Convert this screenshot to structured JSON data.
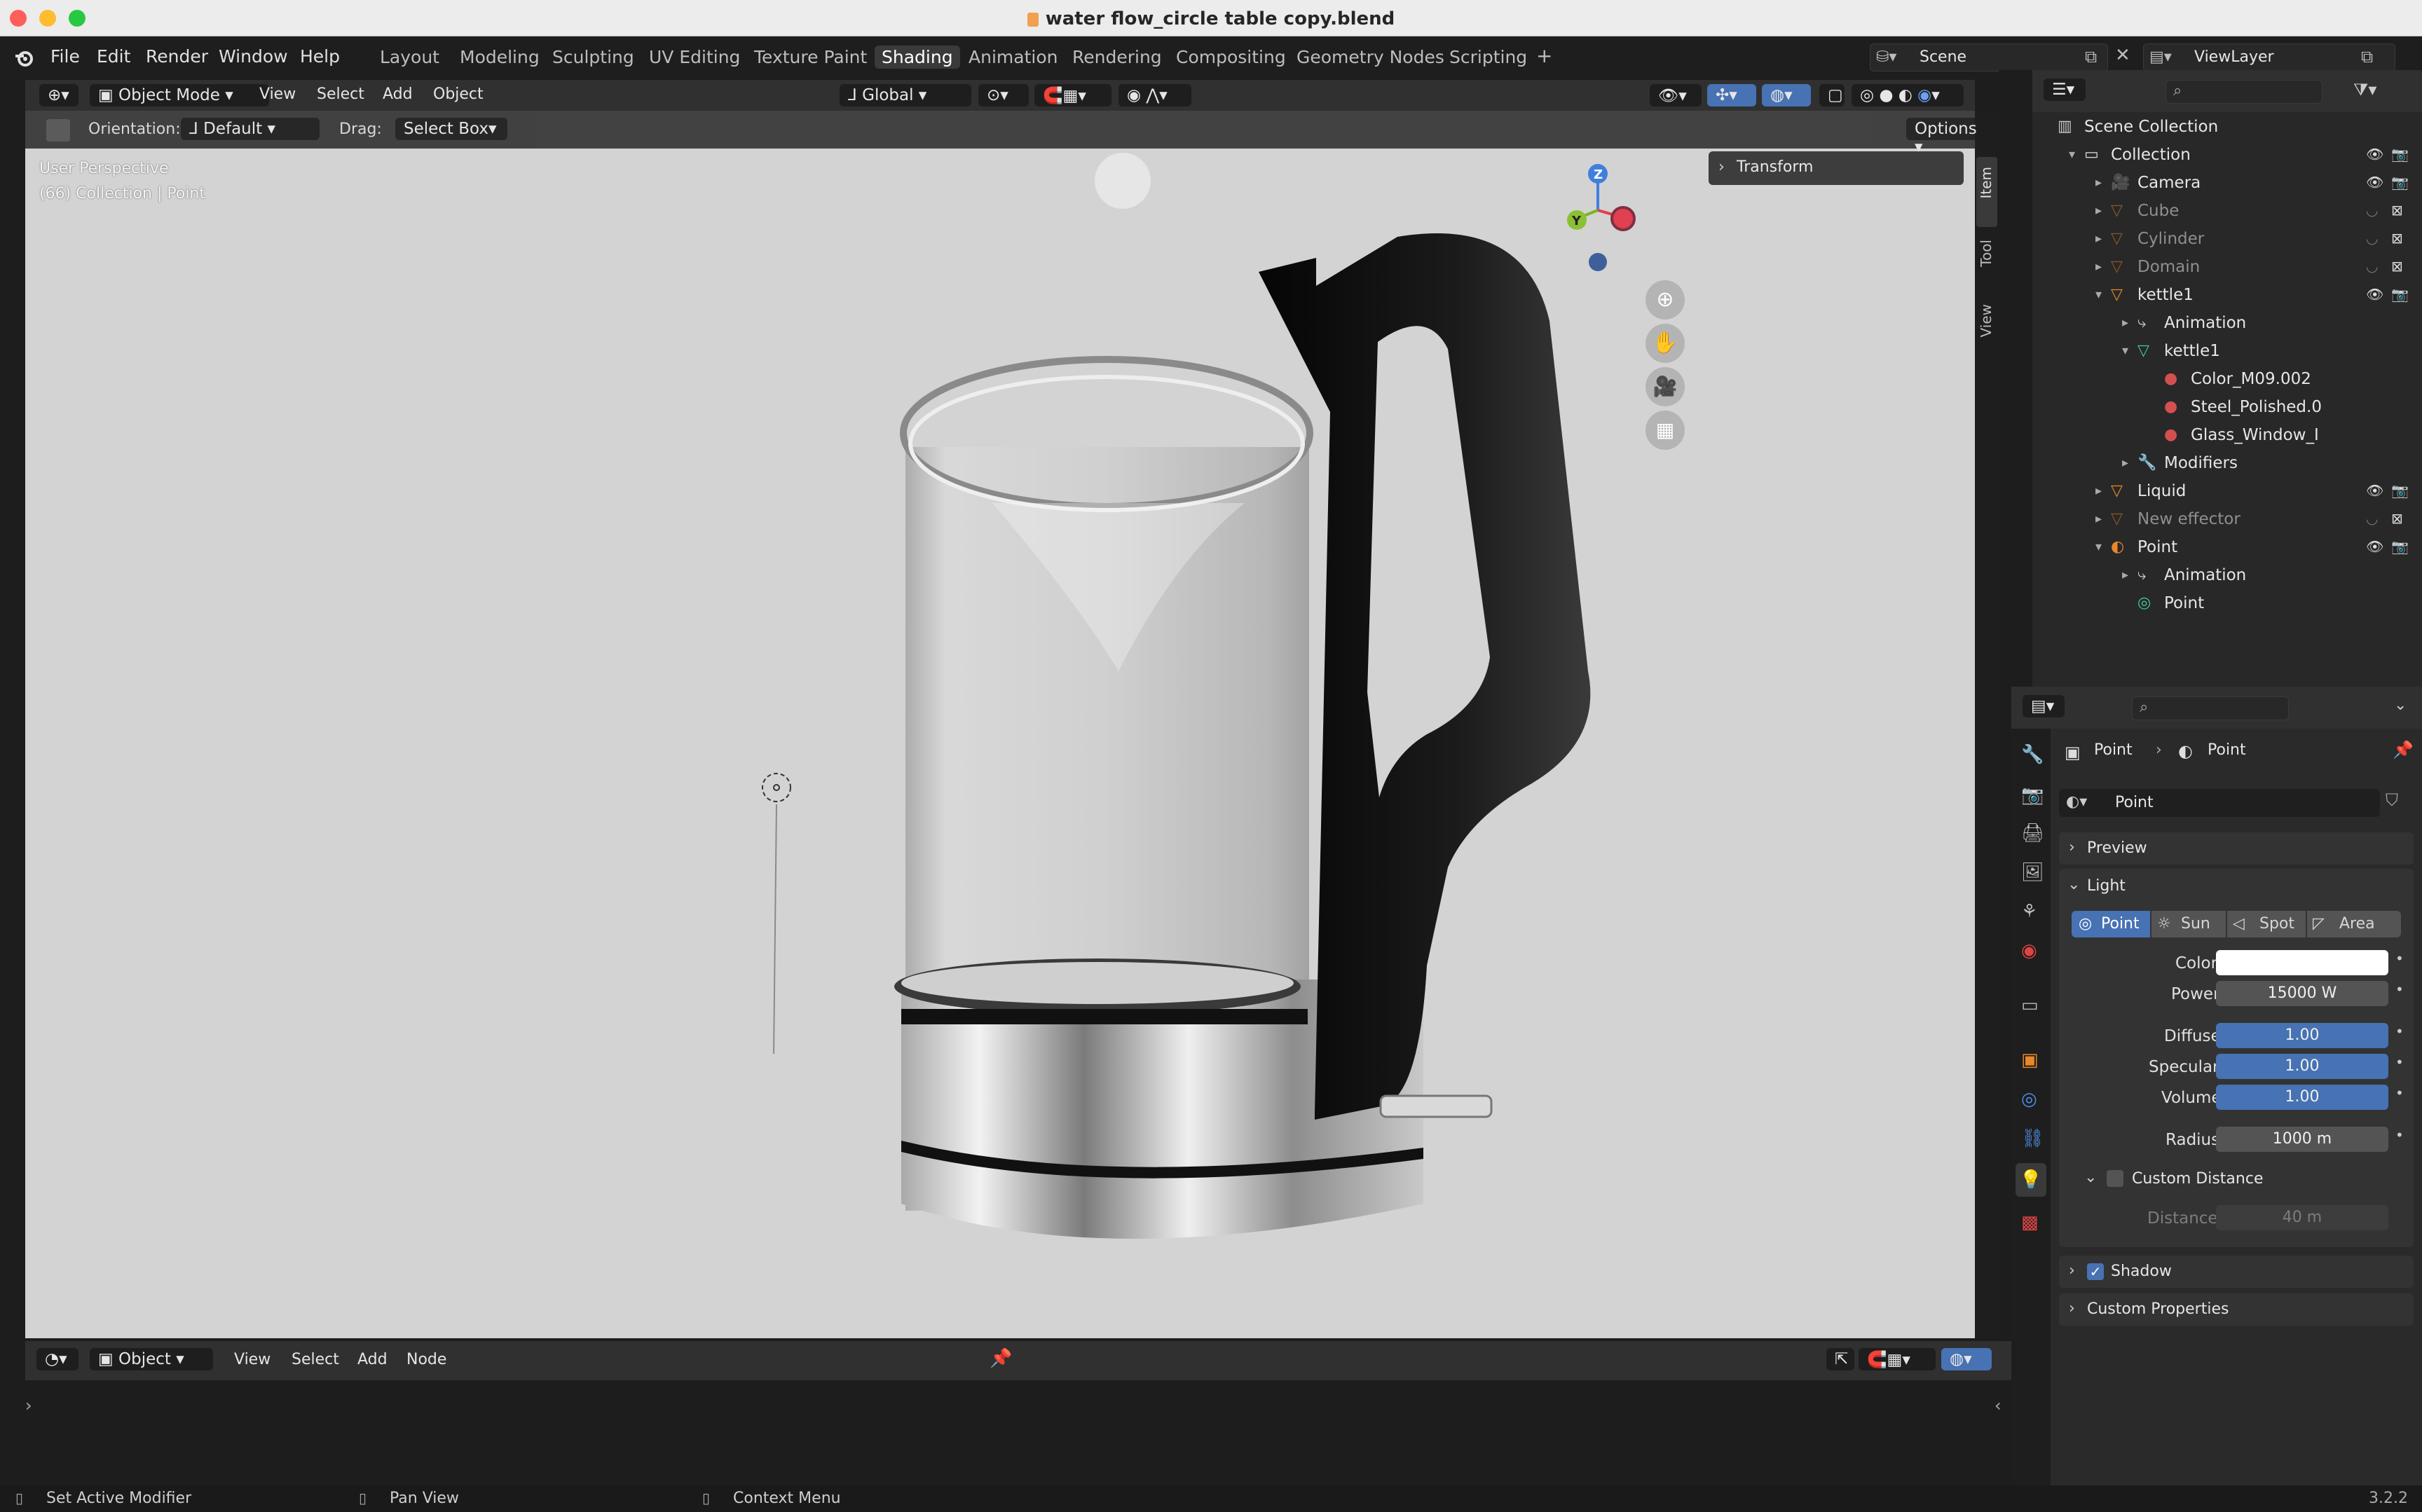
{
  "window": {
    "title": "water flow_circle table copy.blend"
  },
  "menu": [
    "File",
    "Edit",
    "Render",
    "Window",
    "Help"
  ],
  "workspaces": [
    "Layout",
    "Modeling",
    "Sculpting",
    "UV Editing",
    "Texture Paint",
    "Shading",
    "Animation",
    "Rendering",
    "Compositing",
    "Geometry Nodes",
    "Scripting",
    "+"
  ],
  "active_workspace": "Shading",
  "scene": {
    "label": "Scene",
    "view_layer": "ViewLayer"
  },
  "viewport_header": {
    "mode": "Object Mode",
    "menus": [
      "View",
      "Select",
      "Add",
      "Object"
    ],
    "transform_orientation": "Global"
  },
  "tool_options": {
    "orientation_label": "Orientation:",
    "orientation_value": "Default",
    "drag_label": "Drag:",
    "drag_value": "Select Box",
    "options_label": "Options"
  },
  "viewport": {
    "perspective": "User Perspective",
    "context": "(66) Collection | Point",
    "transform_panel": "Transform",
    "side_tabs": [
      "Item",
      "Tool",
      "View"
    ],
    "gizmo_axes": [
      "Z",
      "Y",
      "X"
    ]
  },
  "outliner": {
    "rows": [
      {
        "label": "Scene Collection",
        "indent": 0,
        "dim": false,
        "icon": "scene-collection-icon"
      },
      {
        "label": "Collection",
        "indent": 1,
        "dim": false,
        "icon": "collection-icon"
      },
      {
        "label": "Camera",
        "indent": 2,
        "dim": false,
        "icon": "camera-icon"
      },
      {
        "label": "Cube",
        "indent": 2,
        "dim": true,
        "icon": "mesh-icon"
      },
      {
        "label": "Cylinder",
        "indent": 2,
        "dim": true,
        "icon": "mesh-icon"
      },
      {
        "label": "Domain",
        "indent": 2,
        "dim": true,
        "icon": "mesh-icon"
      },
      {
        "label": "kettle1",
        "indent": 2,
        "dim": false,
        "icon": "mesh-icon"
      },
      {
        "label": "Animation",
        "indent": 3,
        "dim": false,
        "icon": "animation-icon"
      },
      {
        "label": "kettle1",
        "indent": 3,
        "dim": false,
        "icon": "mesh-data-icon"
      },
      {
        "label": "Color_M09.002",
        "indent": 4,
        "dim": false,
        "icon": "material-icon"
      },
      {
        "label": "Steel_Polished.0",
        "indent": 4,
        "dim": false,
        "icon": "material-icon"
      },
      {
        "label": "Glass_Window_I",
        "indent": 4,
        "dim": false,
        "icon": "material-icon"
      },
      {
        "label": "Modifiers",
        "indent": 3,
        "dim": false,
        "icon": "wrench-icon"
      },
      {
        "label": "Liquid",
        "indent": 2,
        "dim": false,
        "icon": "mesh-icon"
      },
      {
        "label": "New effector",
        "indent": 2,
        "dim": true,
        "icon": "mesh-icon"
      },
      {
        "label": "Point",
        "indent": 2,
        "dim": false,
        "icon": "light-icon"
      },
      {
        "label": "Animation",
        "indent": 3,
        "dim": false,
        "icon": "animation-icon"
      },
      {
        "label": "Point",
        "indent": 3,
        "dim": false,
        "icon": "light-data-icon"
      }
    ]
  },
  "properties": {
    "breadcrumb": [
      "Point",
      "Point"
    ],
    "datablock": "Point",
    "sections": {
      "preview": "Preview",
      "light": "Light",
      "shadow": "Shadow",
      "custom_props": "Custom Properties"
    },
    "light_types": [
      "Point",
      "Sun",
      "Spot",
      "Area"
    ],
    "active_light_type": "Point",
    "fields": {
      "color_label": "Color",
      "power_label": "Power",
      "power": "15000 W",
      "diffuse_label": "Diffuse",
      "diffuse": "1.00",
      "specular_label": "Specular",
      "specular": "1.00",
      "volume_label": "Volume",
      "volume": "1.00",
      "radius_label": "Radius",
      "radius": "1000 m",
      "custom_distance": "Custom Distance",
      "distance_label": "Distance",
      "distance": "40 m"
    },
    "shadow_checked": true,
    "light_color": "#ffffff"
  },
  "node_editor": {
    "mode": "Object",
    "menus": [
      "View",
      "Select",
      "Add",
      "Node"
    ]
  },
  "status": {
    "items": [
      "Set Active Modifier",
      "Pan View",
      "Context Menu"
    ],
    "version": "3.2.2"
  },
  "colors": {
    "accent": "#4772b3",
    "active_tab": "#3a3a3a"
  }
}
